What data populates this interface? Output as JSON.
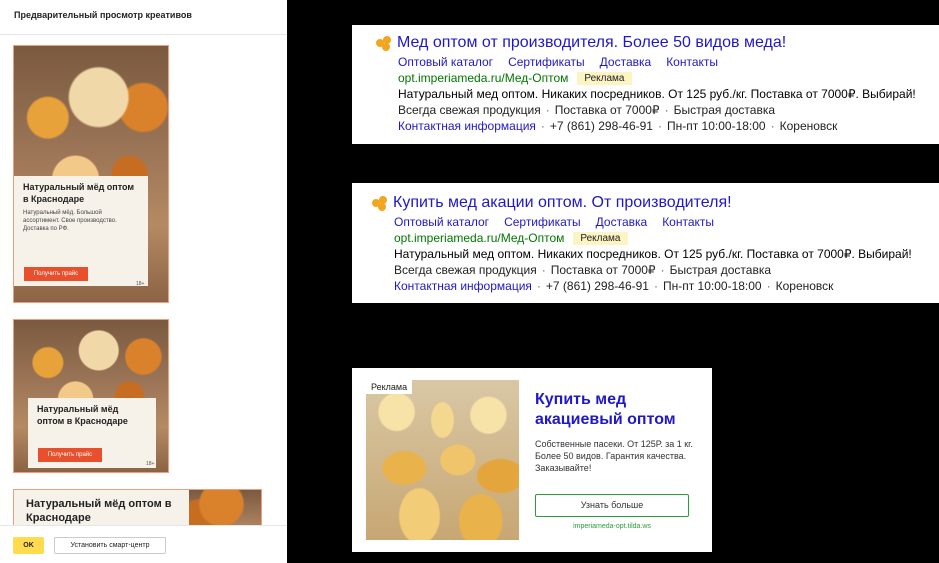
{
  "panel": {
    "title": "Предварительный просмотр креативов",
    "ok_label": "OK",
    "install_label": "Установить смарт-центр"
  },
  "creatives": {
    "headline": "Натуральный мёд оптом в Краснодаре",
    "text": "Натуральный мёд. Большой ассортимент. Свое производство. Доставка по РФ.",
    "button": "Получить прайс",
    "age": "18+"
  },
  "ad1": {
    "title": "Мед оптом от производителя. Более 50 видов меда!",
    "links": [
      "Оптовый каталог",
      "Сертификаты",
      "Доставка",
      "Контакты"
    ],
    "url": "opt.imperiameda.ru/Мед-Оптом",
    "badge": "Реклама",
    "desc": "Натуральный мед оптом. Никаких посредников. От 125 руб./кг. Поставка от 7000₽. Выбирай!",
    "features": [
      "Всегда свежая продукция",
      "Поставка от 7000₽",
      "Быстрая доставка"
    ],
    "contact_link": "Контактная информация",
    "phone": "+7 (861) 298-46-91",
    "hours": "Пн-пт 10:00-18:00",
    "city": "Кореновск"
  },
  "ad2": {
    "title": "Купить мед акации оптом. От производителя!",
    "links": [
      "Оптовый каталог",
      "Сертификаты",
      "Доставка",
      "Контакты"
    ],
    "url": "opt.imperiameda.ru/Мед-Оптом",
    "badge": "Реклама",
    "desc": "Натуральный мед оптом. Никаких посредников. От 125 руб./кг. Поставка от 7000₽. Выбирай!",
    "features": [
      "Всегда свежая продукция",
      "Поставка от 7000₽",
      "Быстрая доставка"
    ],
    "contact_link": "Контактная информация",
    "phone": "+7 (861) 298-46-91",
    "hours": "Пн-пт 10:00-18:00",
    "city": "Кореновск"
  },
  "image_ad": {
    "tag": "Реклама",
    "title": "Купить мед акациевый оптом",
    "text": "Собственные пасеки. От 125Р. за 1 кг. Более 50 видов. Гарантия качества. Заказывайте!",
    "button": "Узнать больше",
    "domain": "imperiameda-opt.tilda.ws"
  },
  "colors": {
    "link": "#2017c8",
    "url": "#007700",
    "accent": "#e8502d",
    "ok": "#ffdb4d"
  }
}
